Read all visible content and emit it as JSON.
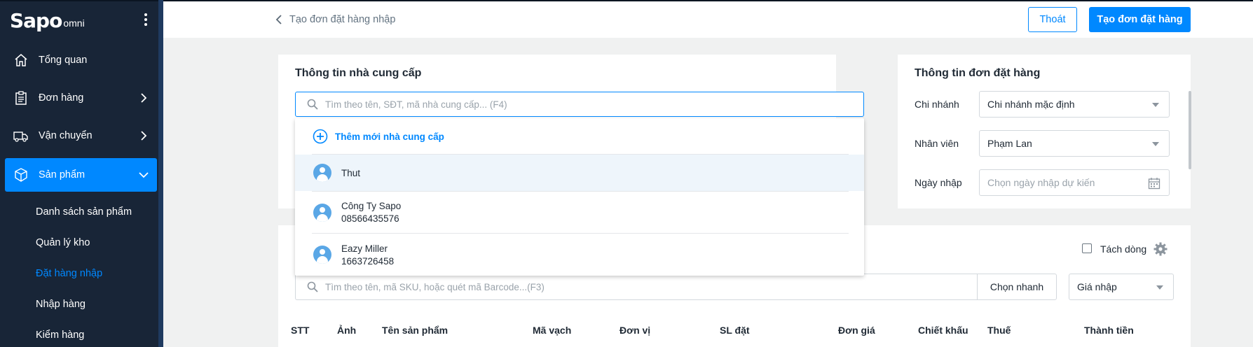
{
  "sidebar": {
    "brand": "Sapo",
    "brand_suffix": "omni",
    "items": [
      {
        "label": "Tổng quan",
        "icon": "home-icon"
      },
      {
        "label": "Đơn hàng",
        "icon": "orders-icon"
      },
      {
        "label": "Vận chuyển",
        "icon": "shipping-icon"
      },
      {
        "label": "Sản phẩm",
        "icon": "product-box-icon"
      }
    ],
    "sub_items": [
      {
        "label": "Danh sách sản phẩm"
      },
      {
        "label": "Quản lý kho"
      },
      {
        "label": "Đặt hàng nhập"
      },
      {
        "label": "Nhập hàng"
      },
      {
        "label": "Kiểm hàng"
      }
    ],
    "accent": "#0088ff",
    "background": "#182537"
  },
  "header": {
    "back_label": "Tạo đơn đặt hàng nhập",
    "exit_label": "Thoát",
    "create_label": "Tạo đơn đặt hàng"
  },
  "supplier": {
    "title": "Thông tin nhà cung cấp",
    "search_placeholder": "Tìm theo tên, SĐT, mã nhà cung cấp... (F4)",
    "add_label": "Thêm mới nhà cung cấp",
    "results": [
      {
        "name": "Thut",
        "phone": ""
      },
      {
        "name": "Công Ty Sapo",
        "phone": "08566435576"
      },
      {
        "name": "Eazy Miller",
        "phone": "1663726458"
      }
    ]
  },
  "order_info": {
    "title": "Thông tin đơn đặt hàng",
    "branch_label": "Chi nhánh",
    "branch_value": "Chi nhánh mặc định",
    "staff_label": "Nhân viên",
    "staff_value": "Phạm Lan",
    "date_label": "Ngày nhập",
    "date_placeholder": "Chọn ngày nhập dự kiến"
  },
  "products": {
    "split_label": "Tách dòng",
    "search_placeholder": "Tìm theo tên, mã SKU, hoặc quét mã Barcode...(F3)",
    "quick_pick_label": "Chọn nhanh",
    "price_type": "Giá nhập",
    "columns": [
      "STT",
      "Ảnh",
      "Tên sản phẩm",
      "Mã vạch",
      "Đơn vị",
      "SL đặt",
      "Đơn giá",
      "Chiết khấu",
      "Thuế",
      "Thành tiền"
    ]
  }
}
